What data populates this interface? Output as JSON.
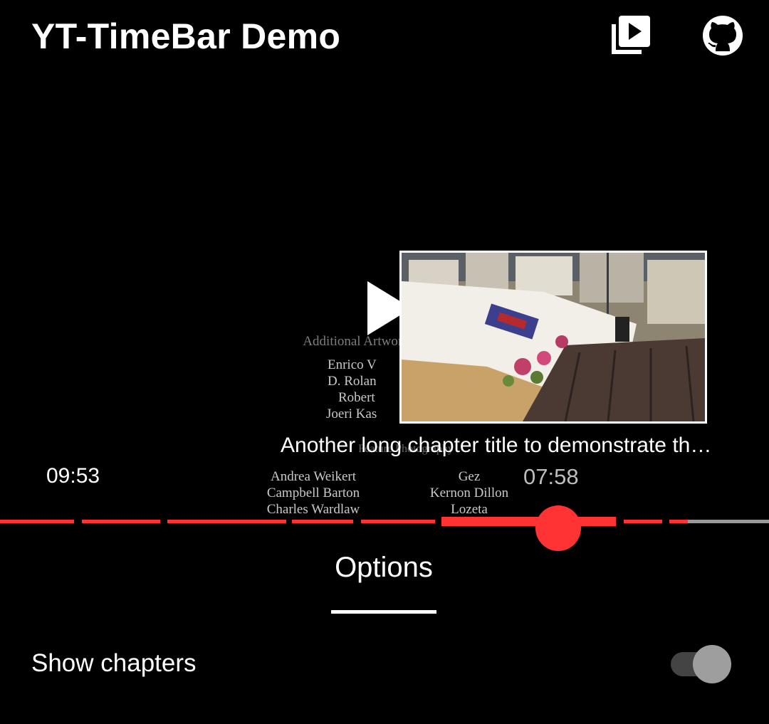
{
  "app_bar": {
    "title": "YT-TimeBar Demo",
    "icons": [
      "video-library-icon",
      "github-icon"
    ]
  },
  "player": {
    "state": "paused",
    "current_time": "09:53",
    "preview_time": "07:58",
    "preview_chapter_title": "Another long chapter title to demonstrate th…",
    "credits": {
      "block_top": {
        "heading": "Additional Artwork",
        "names": [
          "Enrico V",
          "D. Rolan",
          "Robert",
          "Joeri Kas"
        ]
      },
      "block_bottom": {
        "heading": "Feature Photography",
        "left_names": [
          "Andrea Weikert",
          "Campbell Barton",
          "Charles Wardlaw"
        ],
        "right_names": [
          "Gez",
          "Kernon Dillon",
          "Lozeta"
        ]
      }
    }
  },
  "timebar": {
    "played_fraction": 0.725,
    "colors": {
      "played": "#ff3333",
      "remaining": "#9a9a9a",
      "scrubber": "#ff3333"
    }
  },
  "tabs": {
    "options_label": "Options"
  },
  "settings": {
    "show_chapters": {
      "label": "Show chapters",
      "enabled": false
    }
  }
}
